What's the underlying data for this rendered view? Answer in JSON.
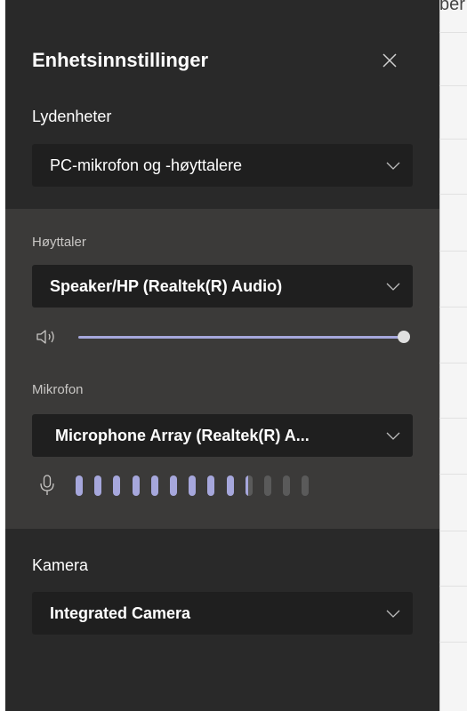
{
  "background": {
    "partial_text": "ber"
  },
  "panel": {
    "title": "Enhetsinnstillinger",
    "audio_devices": {
      "label": "Lydenheter",
      "selected": "PC-mikrofon og -høyttalere"
    },
    "speaker": {
      "label": "Høyttaler",
      "selected": "Speaker/HP (Realtek(R) Audio)",
      "volume_percent": 100
    },
    "microphone": {
      "label": "Mikrofon",
      "selected": "Microphone Array (Realtek(R) A...",
      "level_bars_total": 13,
      "level_bars_active": 9
    },
    "camera": {
      "label": "Kamera",
      "selected": "Integrated Camera"
    }
  },
  "colors": {
    "panel_bg": "#292929",
    "section_bg": "#3b3a39",
    "dropdown_bg": "#1f1f1f",
    "accent": "#a6a7dc",
    "bar_inactive": "#5a5a5a"
  },
  "icons": {
    "close": "close-icon",
    "chevron": "chevron-down-icon",
    "speaker": "speaker-icon",
    "mic": "microphone-icon"
  }
}
